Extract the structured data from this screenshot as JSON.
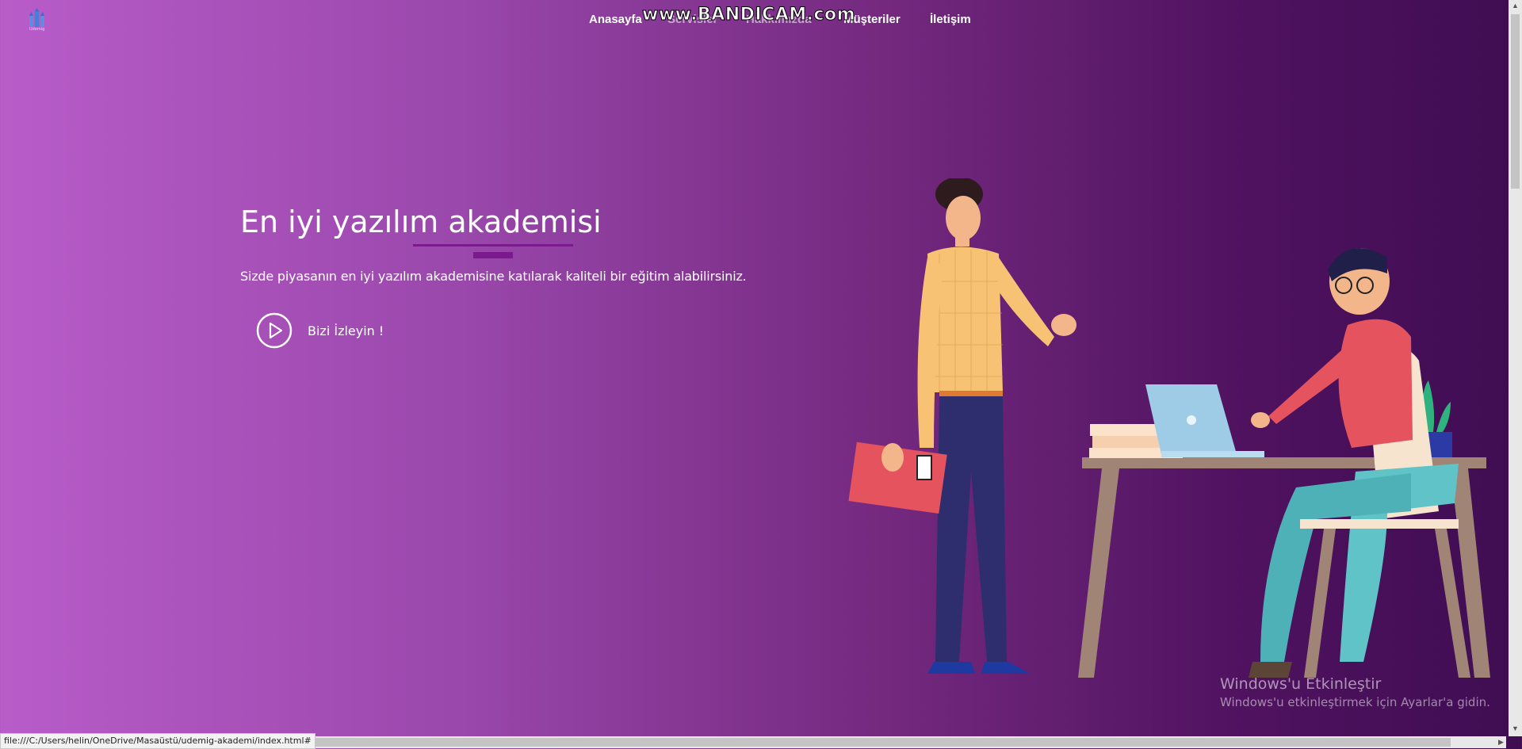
{
  "brand": {
    "logo_text": "Udemig",
    "icon": "castle-logo-icon"
  },
  "nav": {
    "items": [
      "Anasayfa",
      "Servisler",
      "Hakkımızda",
      "Müşteriler",
      "İletişim"
    ]
  },
  "overlay": {
    "watermark": "www.BANDICAM.com"
  },
  "hero": {
    "title": "En iyi yazılım akademisi",
    "subtitle": "Sizde piyasanın en iyi yazılım akademisine katılarak kaliteli bir eğitim alabilirsiniz.",
    "cta_label": "Bizi İzleyin !",
    "cta_icon": "play-icon"
  },
  "windows_activation": {
    "title": "Windows'u Etkinleştir",
    "subtitle": "Windows'u etkinleştirmek için Ayarlar'a gidin."
  },
  "statusbar": {
    "url": "file:///C:/Users/helin/OneDrive/Masaüstü/udemig-akademi/index.html#"
  },
  "colors": {
    "gradient_start": "#b85cc9",
    "gradient_end": "#3f0d52",
    "accent": "#7a1a8c",
    "text": "#ffffff"
  }
}
